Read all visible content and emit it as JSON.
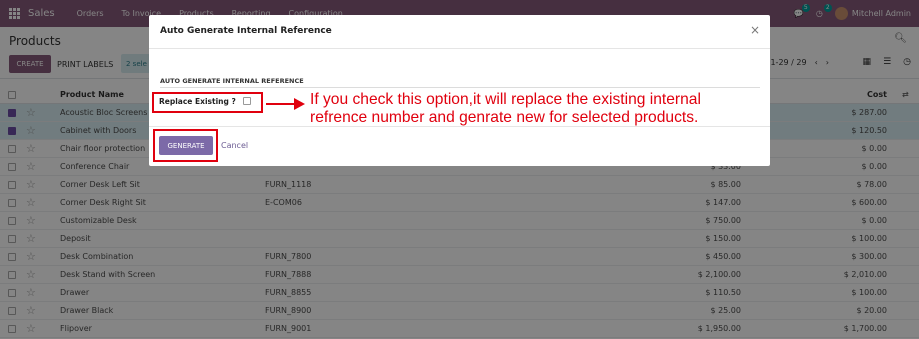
{
  "navbar": {
    "app_name": "Sales",
    "menu": [
      "Orders",
      "To Invoice",
      "Products",
      "Reporting",
      "Configuration"
    ],
    "messages_count": "5",
    "activities_count": "2",
    "user_name": "Mitchell Admin"
  },
  "control": {
    "breadcrumb": "Products",
    "create_label": "CREATE",
    "print_label": "PRINT LABELS",
    "selection_text": "2 sele",
    "pager": "1-29 / 29",
    "pager_prev": "‹",
    "pager_next": "›"
  },
  "list": {
    "headers": {
      "name": "Product Name",
      "cost": "Cost"
    },
    "rows": [
      {
        "name": "Acoustic Bloc Screens",
        "ref": "",
        "price": "",
        "cost": "$ 287.00",
        "selected": true
      },
      {
        "name": "Cabinet with Doors",
        "ref": "",
        "price": "",
        "cost": "$ 120.50",
        "selected": true
      },
      {
        "name": "Chair floor protection",
        "ref": "",
        "price": "",
        "cost": "$ 0.00",
        "selected": false
      },
      {
        "name": "Conference Chair",
        "ref": "",
        "price": "$ 33.00",
        "cost": "$ 0.00",
        "selected": false
      },
      {
        "name": "Corner Desk Left Sit",
        "ref": "FURN_1118",
        "price": "$ 85.00",
        "cost": "$ 78.00",
        "selected": false
      },
      {
        "name": "Corner Desk Right Sit",
        "ref": "E-COM06",
        "price": "$ 147.00",
        "cost": "$ 600.00",
        "selected": false
      },
      {
        "name": "Customizable Desk",
        "ref": "",
        "price": "$ 750.00",
        "cost": "$ 0.00",
        "selected": false
      },
      {
        "name": "Deposit",
        "ref": "",
        "price": "$ 150.00",
        "cost": "$ 100.00",
        "selected": false
      },
      {
        "name": "Desk Combination",
        "ref": "FURN_7800",
        "price": "$ 450.00",
        "cost": "$ 300.00",
        "selected": false
      },
      {
        "name": "Desk Stand with Screen",
        "ref": "FURN_7888",
        "price": "$ 2,100.00",
        "cost": "$ 2,010.00",
        "selected": false
      },
      {
        "name": "Drawer",
        "ref": "FURN_8855",
        "price": "$ 110.50",
        "cost": "$ 100.00",
        "selected": false
      },
      {
        "name": "Drawer Black",
        "ref": "FURN_8900",
        "price": "$ 25.00",
        "cost": "$ 20.00",
        "selected": false
      },
      {
        "name": "Flipover",
        "ref": "FURN_9001",
        "price": "$ 1,950.00",
        "cost": "$ 1,700.00",
        "selected": false
      }
    ]
  },
  "modal": {
    "title": "Auto Generate Internal Reference",
    "close_glyph": "×",
    "section_title": "AUTO GENERATE INTERNAL REFERENCE",
    "replace_label": "Replace Existing ?",
    "generate_label": "GENERATE",
    "cancel_label": "Cancel"
  },
  "annotation": {
    "note": "If you check this option,it will replace the existing internal refrence number and genrate new for selected products.",
    "color": "#e0000e"
  },
  "colors": {
    "brand": "#875a7b",
    "primary_button": "#7c6aa8",
    "selected_row": "#d8eef3"
  }
}
